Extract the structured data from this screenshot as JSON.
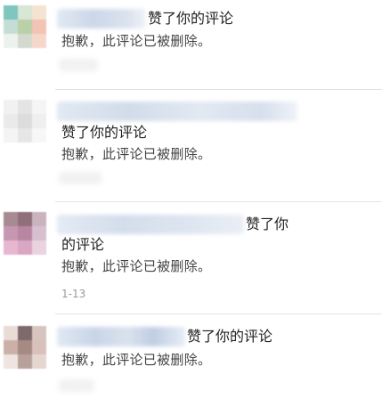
{
  "notifications": [
    {
      "action": "赞了你的评论",
      "deleted": "抱歉，此评论已被删除。"
    },
    {
      "action": "赞了你的评论",
      "deleted": "抱歉，此评论已被删除。"
    },
    {
      "action_line1": "赞了你",
      "action_line2": "的评论",
      "deleted": "抱歉，此评论已被删除。",
      "date": "1-13"
    },
    {
      "action": "赞了你的评论",
      "deleted": "抱歉，此评论已被删除。"
    }
  ],
  "colors": {
    "divider": "#e3e3e3",
    "text_primary": "#222222",
    "text_secondary": "#444444",
    "text_date": "#9a9a9a"
  }
}
